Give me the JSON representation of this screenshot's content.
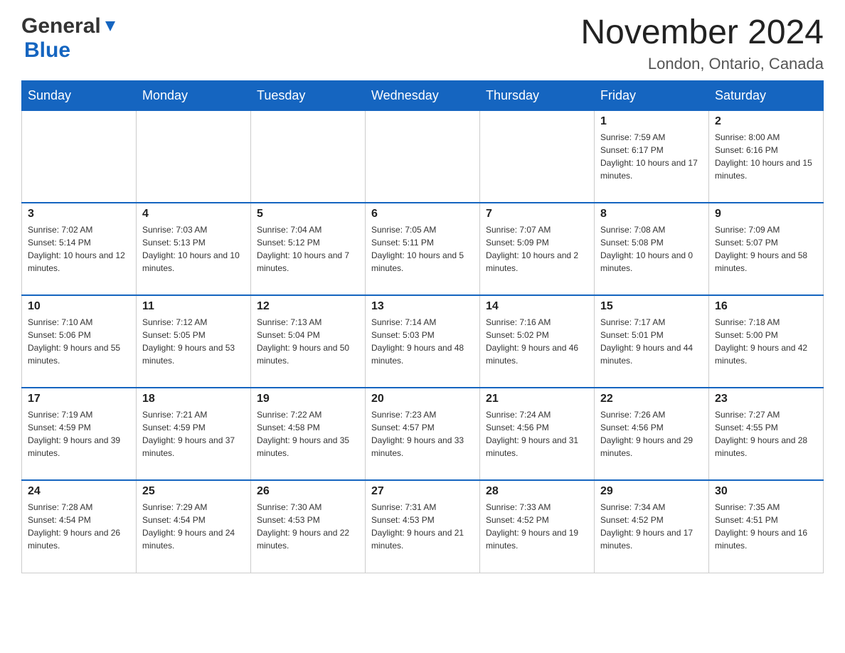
{
  "header": {
    "logo_general": "General",
    "logo_blue": "Blue",
    "month_title": "November 2024",
    "location": "London, Ontario, Canada"
  },
  "weekdays": [
    "Sunday",
    "Monday",
    "Tuesday",
    "Wednesday",
    "Thursday",
    "Friday",
    "Saturday"
  ],
  "weeks": [
    [
      {
        "day": "",
        "sunrise": "",
        "sunset": "",
        "daylight": ""
      },
      {
        "day": "",
        "sunrise": "",
        "sunset": "",
        "daylight": ""
      },
      {
        "day": "",
        "sunrise": "",
        "sunset": "",
        "daylight": ""
      },
      {
        "day": "",
        "sunrise": "",
        "sunset": "",
        "daylight": ""
      },
      {
        "day": "",
        "sunrise": "",
        "sunset": "",
        "daylight": ""
      },
      {
        "day": "1",
        "sunrise": "Sunrise: 7:59 AM",
        "sunset": "Sunset: 6:17 PM",
        "daylight": "Daylight: 10 hours and 17 minutes."
      },
      {
        "day": "2",
        "sunrise": "Sunrise: 8:00 AM",
        "sunset": "Sunset: 6:16 PM",
        "daylight": "Daylight: 10 hours and 15 minutes."
      }
    ],
    [
      {
        "day": "3",
        "sunrise": "Sunrise: 7:02 AM",
        "sunset": "Sunset: 5:14 PM",
        "daylight": "Daylight: 10 hours and 12 minutes."
      },
      {
        "day": "4",
        "sunrise": "Sunrise: 7:03 AM",
        "sunset": "Sunset: 5:13 PM",
        "daylight": "Daylight: 10 hours and 10 minutes."
      },
      {
        "day": "5",
        "sunrise": "Sunrise: 7:04 AM",
        "sunset": "Sunset: 5:12 PM",
        "daylight": "Daylight: 10 hours and 7 minutes."
      },
      {
        "day": "6",
        "sunrise": "Sunrise: 7:05 AM",
        "sunset": "Sunset: 5:11 PM",
        "daylight": "Daylight: 10 hours and 5 minutes."
      },
      {
        "day": "7",
        "sunrise": "Sunrise: 7:07 AM",
        "sunset": "Sunset: 5:09 PM",
        "daylight": "Daylight: 10 hours and 2 minutes."
      },
      {
        "day": "8",
        "sunrise": "Sunrise: 7:08 AM",
        "sunset": "Sunset: 5:08 PM",
        "daylight": "Daylight: 10 hours and 0 minutes."
      },
      {
        "day": "9",
        "sunrise": "Sunrise: 7:09 AM",
        "sunset": "Sunset: 5:07 PM",
        "daylight": "Daylight: 9 hours and 58 minutes."
      }
    ],
    [
      {
        "day": "10",
        "sunrise": "Sunrise: 7:10 AM",
        "sunset": "Sunset: 5:06 PM",
        "daylight": "Daylight: 9 hours and 55 minutes."
      },
      {
        "day": "11",
        "sunrise": "Sunrise: 7:12 AM",
        "sunset": "Sunset: 5:05 PM",
        "daylight": "Daylight: 9 hours and 53 minutes."
      },
      {
        "day": "12",
        "sunrise": "Sunrise: 7:13 AM",
        "sunset": "Sunset: 5:04 PM",
        "daylight": "Daylight: 9 hours and 50 minutes."
      },
      {
        "day": "13",
        "sunrise": "Sunrise: 7:14 AM",
        "sunset": "Sunset: 5:03 PM",
        "daylight": "Daylight: 9 hours and 48 minutes."
      },
      {
        "day": "14",
        "sunrise": "Sunrise: 7:16 AM",
        "sunset": "Sunset: 5:02 PM",
        "daylight": "Daylight: 9 hours and 46 minutes."
      },
      {
        "day": "15",
        "sunrise": "Sunrise: 7:17 AM",
        "sunset": "Sunset: 5:01 PM",
        "daylight": "Daylight: 9 hours and 44 minutes."
      },
      {
        "day": "16",
        "sunrise": "Sunrise: 7:18 AM",
        "sunset": "Sunset: 5:00 PM",
        "daylight": "Daylight: 9 hours and 42 minutes."
      }
    ],
    [
      {
        "day": "17",
        "sunrise": "Sunrise: 7:19 AM",
        "sunset": "Sunset: 4:59 PM",
        "daylight": "Daylight: 9 hours and 39 minutes."
      },
      {
        "day": "18",
        "sunrise": "Sunrise: 7:21 AM",
        "sunset": "Sunset: 4:59 PM",
        "daylight": "Daylight: 9 hours and 37 minutes."
      },
      {
        "day": "19",
        "sunrise": "Sunrise: 7:22 AM",
        "sunset": "Sunset: 4:58 PM",
        "daylight": "Daylight: 9 hours and 35 minutes."
      },
      {
        "day": "20",
        "sunrise": "Sunrise: 7:23 AM",
        "sunset": "Sunset: 4:57 PM",
        "daylight": "Daylight: 9 hours and 33 minutes."
      },
      {
        "day": "21",
        "sunrise": "Sunrise: 7:24 AM",
        "sunset": "Sunset: 4:56 PM",
        "daylight": "Daylight: 9 hours and 31 minutes."
      },
      {
        "day": "22",
        "sunrise": "Sunrise: 7:26 AM",
        "sunset": "Sunset: 4:56 PM",
        "daylight": "Daylight: 9 hours and 29 minutes."
      },
      {
        "day": "23",
        "sunrise": "Sunrise: 7:27 AM",
        "sunset": "Sunset: 4:55 PM",
        "daylight": "Daylight: 9 hours and 28 minutes."
      }
    ],
    [
      {
        "day": "24",
        "sunrise": "Sunrise: 7:28 AM",
        "sunset": "Sunset: 4:54 PM",
        "daylight": "Daylight: 9 hours and 26 minutes."
      },
      {
        "day": "25",
        "sunrise": "Sunrise: 7:29 AM",
        "sunset": "Sunset: 4:54 PM",
        "daylight": "Daylight: 9 hours and 24 minutes."
      },
      {
        "day": "26",
        "sunrise": "Sunrise: 7:30 AM",
        "sunset": "Sunset: 4:53 PM",
        "daylight": "Daylight: 9 hours and 22 minutes."
      },
      {
        "day": "27",
        "sunrise": "Sunrise: 7:31 AM",
        "sunset": "Sunset: 4:53 PM",
        "daylight": "Daylight: 9 hours and 21 minutes."
      },
      {
        "day": "28",
        "sunrise": "Sunrise: 7:33 AM",
        "sunset": "Sunset: 4:52 PM",
        "daylight": "Daylight: 9 hours and 19 minutes."
      },
      {
        "day": "29",
        "sunrise": "Sunrise: 7:34 AM",
        "sunset": "Sunset: 4:52 PM",
        "daylight": "Daylight: 9 hours and 17 minutes."
      },
      {
        "day": "30",
        "sunrise": "Sunrise: 7:35 AM",
        "sunset": "Sunset: 4:51 PM",
        "daylight": "Daylight: 9 hours and 16 minutes."
      }
    ]
  ]
}
